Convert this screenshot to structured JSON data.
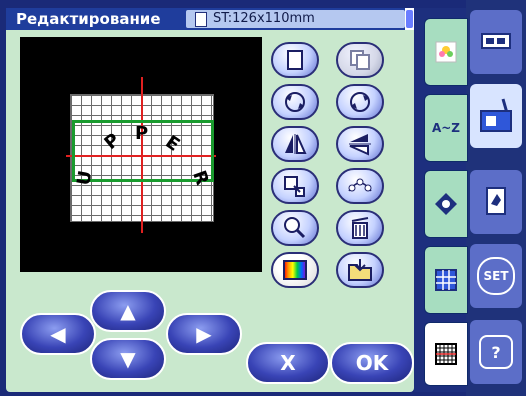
{
  "titlebar": {
    "title": "Редактирование",
    "size": "ST:126x110mm"
  },
  "canvas": {
    "pattern_letters": [
      "U",
      "P",
      "P",
      "E",
      "R"
    ]
  },
  "buttons": {
    "ok": "OK",
    "cancel": "X",
    "arrows": {
      "up": "▲",
      "down": "▼",
      "left": "◀",
      "right": "▶"
    }
  },
  "tabs": {
    "alphabet": "A~Z"
  },
  "modes": {
    "set": "SET",
    "help": "?"
  }
}
